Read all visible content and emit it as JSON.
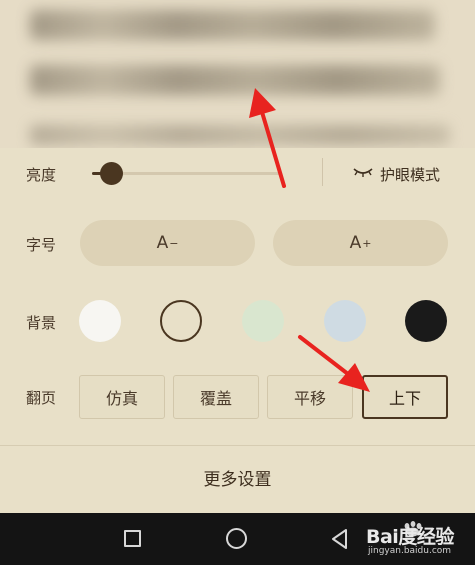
{
  "settings": {
    "brightness": {
      "label": "亮度",
      "level": 0.1,
      "eye_mode_label": "护眼模式",
      "eye_icon": "eye-closed-icon"
    },
    "font_size": {
      "label": "字号",
      "decrease_label": "A",
      "decrease_mark": "−",
      "increase_label": "A",
      "increase_mark": "+"
    },
    "background": {
      "label": "背景",
      "swatches": [
        {
          "color": "#f7f6f2",
          "selected": false
        },
        {
          "color": "#e8e0c8",
          "selected": true
        },
        {
          "color": "#d9e6cf",
          "selected": false
        },
        {
          "color": "#cfdbe3",
          "selected": false
        },
        {
          "color": "#1a1a1a",
          "selected": false
        }
      ]
    },
    "page_turn": {
      "label": "翻页",
      "options": [
        "仿真",
        "覆盖",
        "平移",
        "上下"
      ],
      "selected": "上下"
    },
    "more_label": "更多设置"
  },
  "navbar": {
    "recent_icon": "square-icon",
    "home_icon": "circle-icon",
    "back_icon": "triangle-back-icon"
  },
  "watermark": {
    "brand": "Bai度经验",
    "url": "jingyan.baidu.com"
  },
  "colors": {
    "panel_bg": "#e8e0c8",
    "accent": "#4a3620",
    "annotation": "#e8231f"
  }
}
